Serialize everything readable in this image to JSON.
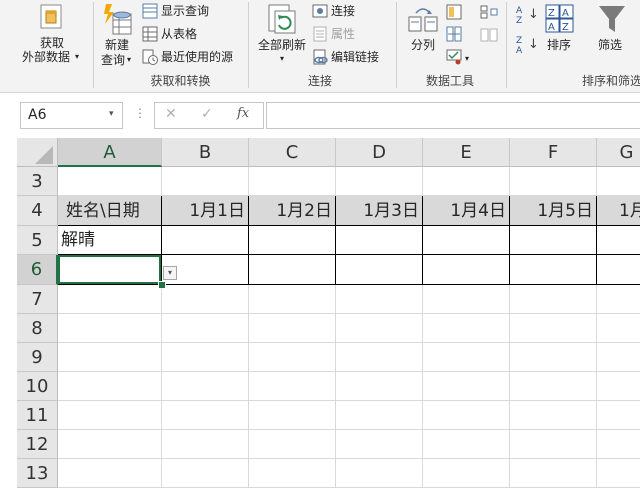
{
  "ribbon": {
    "get_data": {
      "line1": "获取",
      "line2": "外部数据",
      "icon": "database-icon"
    },
    "new_query": {
      "line1": "新建",
      "line2": "查询",
      "icon": "new-query-icon"
    },
    "show_queries": "显示查询",
    "from_table": "从表格",
    "recent_sources": "最近使用的源",
    "group_get_transform": "获取和转换",
    "refresh_all": "全部刷新",
    "connections": "连接",
    "properties": "属性",
    "edit_links": "编辑链接",
    "group_connections": "连接",
    "text_to_columns": "分列",
    "group_data_tools": "数据工具",
    "sort": "排序",
    "filter": "筛选",
    "group_sort_filter": "排序和筛选",
    "sort_az": "A Z",
    "sort_za": "Z A"
  },
  "formula_bar": {
    "name_box": "A6",
    "cancel_symbol": "✕",
    "enter_symbol": "✓",
    "fx_symbol": "fx",
    "formula": ""
  },
  "grid": {
    "columns": [
      "A",
      "B",
      "C",
      "D",
      "E",
      "F",
      "G"
    ],
    "selected_column": "A",
    "rows": [
      "3",
      "4",
      "5",
      "6",
      "7",
      "8",
      "9",
      "10",
      "11",
      "12",
      "13"
    ],
    "selected_row": "6",
    "header_row": [
      "姓名\\日期",
      "1月1日",
      "1月2日",
      "1月3日",
      "1月4日",
      "1月5日",
      "1月"
    ],
    "a5": "解晴"
  },
  "colors": {
    "ribbon_bg": "#f3f3f3",
    "header_bg": "#e6e6e6",
    "selected_header_bg": "#d2d2d2",
    "accent_green": "#217346",
    "table_header_fill": "#d9d9d9"
  }
}
